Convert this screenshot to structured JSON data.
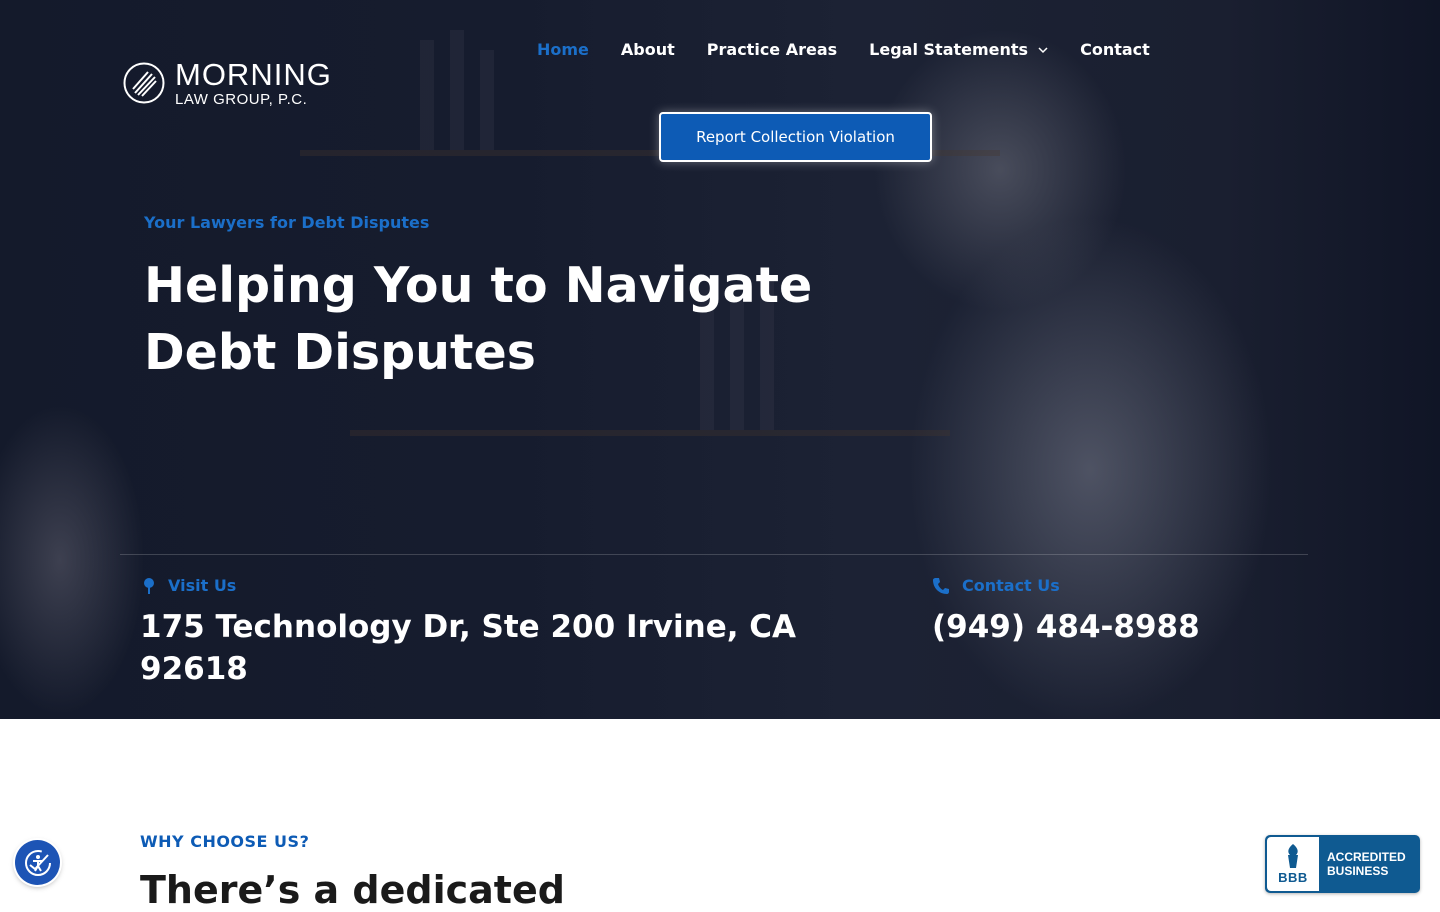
{
  "brand": {
    "name": "MORNING",
    "subtitle": "LAW GROUP, P.C."
  },
  "nav": {
    "items": [
      {
        "label": "Home",
        "active": true
      },
      {
        "label": "About"
      },
      {
        "label": "Practice Areas"
      },
      {
        "label": "Legal Statements",
        "has_dropdown": true
      },
      {
        "label": "Contact"
      }
    ]
  },
  "cta": {
    "label": "Report Collection Violation"
  },
  "hero": {
    "eyebrow": "Your Lawyers for Debt Disputes",
    "headline": "Helping You to Navigate Debt Disputes"
  },
  "contact_info": {
    "visit": {
      "label": "Visit Us",
      "value": "175 Technology Dr, Ste 200 Irvine, CA 92618",
      "icon": "map-pin-icon"
    },
    "contact": {
      "label": "Contact Us",
      "value": "(949) 484-8988",
      "icon": "phone-icon"
    }
  },
  "why": {
    "eyebrow": "WHY CHOOSE US?",
    "headline": "There’s a dedicated"
  },
  "badge": {
    "left": "BBB",
    "line1": "ACCREDITED",
    "line2": "BUSINESS"
  },
  "colors": {
    "accent": "#1b6fc9",
    "cta_bg": "#0d5bb5",
    "hero_bg": "#161c2e",
    "bbb_blue": "#0f5a91"
  }
}
